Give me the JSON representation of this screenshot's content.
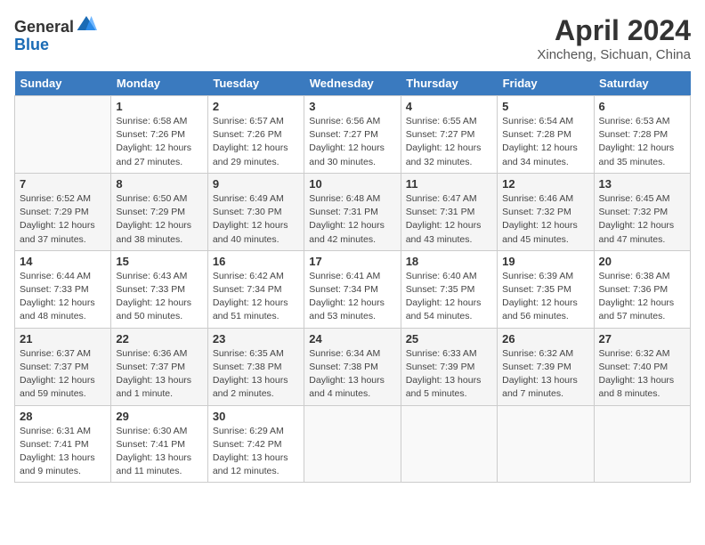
{
  "header": {
    "logo_line1": "General",
    "logo_line2": "Blue",
    "title": "April 2024",
    "subtitle": "Xincheng, Sichuan, China"
  },
  "calendar": {
    "weekdays": [
      "Sunday",
      "Monday",
      "Tuesday",
      "Wednesday",
      "Thursday",
      "Friday",
      "Saturday"
    ],
    "weeks": [
      [
        {
          "day": "",
          "info": ""
        },
        {
          "day": "1",
          "info": "Sunrise: 6:58 AM\nSunset: 7:26 PM\nDaylight: 12 hours\nand 27 minutes."
        },
        {
          "day": "2",
          "info": "Sunrise: 6:57 AM\nSunset: 7:26 PM\nDaylight: 12 hours\nand 29 minutes."
        },
        {
          "day": "3",
          "info": "Sunrise: 6:56 AM\nSunset: 7:27 PM\nDaylight: 12 hours\nand 30 minutes."
        },
        {
          "day": "4",
          "info": "Sunrise: 6:55 AM\nSunset: 7:27 PM\nDaylight: 12 hours\nand 32 minutes."
        },
        {
          "day": "5",
          "info": "Sunrise: 6:54 AM\nSunset: 7:28 PM\nDaylight: 12 hours\nand 34 minutes."
        },
        {
          "day": "6",
          "info": "Sunrise: 6:53 AM\nSunset: 7:28 PM\nDaylight: 12 hours\nand 35 minutes."
        }
      ],
      [
        {
          "day": "7",
          "info": "Sunrise: 6:52 AM\nSunset: 7:29 PM\nDaylight: 12 hours\nand 37 minutes."
        },
        {
          "day": "8",
          "info": "Sunrise: 6:50 AM\nSunset: 7:29 PM\nDaylight: 12 hours\nand 38 minutes."
        },
        {
          "day": "9",
          "info": "Sunrise: 6:49 AM\nSunset: 7:30 PM\nDaylight: 12 hours\nand 40 minutes."
        },
        {
          "day": "10",
          "info": "Sunrise: 6:48 AM\nSunset: 7:31 PM\nDaylight: 12 hours\nand 42 minutes."
        },
        {
          "day": "11",
          "info": "Sunrise: 6:47 AM\nSunset: 7:31 PM\nDaylight: 12 hours\nand 43 minutes."
        },
        {
          "day": "12",
          "info": "Sunrise: 6:46 AM\nSunset: 7:32 PM\nDaylight: 12 hours\nand 45 minutes."
        },
        {
          "day": "13",
          "info": "Sunrise: 6:45 AM\nSunset: 7:32 PM\nDaylight: 12 hours\nand 47 minutes."
        }
      ],
      [
        {
          "day": "14",
          "info": "Sunrise: 6:44 AM\nSunset: 7:33 PM\nDaylight: 12 hours\nand 48 minutes."
        },
        {
          "day": "15",
          "info": "Sunrise: 6:43 AM\nSunset: 7:33 PM\nDaylight: 12 hours\nand 50 minutes."
        },
        {
          "day": "16",
          "info": "Sunrise: 6:42 AM\nSunset: 7:34 PM\nDaylight: 12 hours\nand 51 minutes."
        },
        {
          "day": "17",
          "info": "Sunrise: 6:41 AM\nSunset: 7:34 PM\nDaylight: 12 hours\nand 53 minutes."
        },
        {
          "day": "18",
          "info": "Sunrise: 6:40 AM\nSunset: 7:35 PM\nDaylight: 12 hours\nand 54 minutes."
        },
        {
          "day": "19",
          "info": "Sunrise: 6:39 AM\nSunset: 7:35 PM\nDaylight: 12 hours\nand 56 minutes."
        },
        {
          "day": "20",
          "info": "Sunrise: 6:38 AM\nSunset: 7:36 PM\nDaylight: 12 hours\nand 57 minutes."
        }
      ],
      [
        {
          "day": "21",
          "info": "Sunrise: 6:37 AM\nSunset: 7:37 PM\nDaylight: 12 hours\nand 59 minutes."
        },
        {
          "day": "22",
          "info": "Sunrise: 6:36 AM\nSunset: 7:37 PM\nDaylight: 13 hours\nand 1 minute."
        },
        {
          "day": "23",
          "info": "Sunrise: 6:35 AM\nSunset: 7:38 PM\nDaylight: 13 hours\nand 2 minutes."
        },
        {
          "day": "24",
          "info": "Sunrise: 6:34 AM\nSunset: 7:38 PM\nDaylight: 13 hours\nand 4 minutes."
        },
        {
          "day": "25",
          "info": "Sunrise: 6:33 AM\nSunset: 7:39 PM\nDaylight: 13 hours\nand 5 minutes."
        },
        {
          "day": "26",
          "info": "Sunrise: 6:32 AM\nSunset: 7:39 PM\nDaylight: 13 hours\nand 7 minutes."
        },
        {
          "day": "27",
          "info": "Sunrise: 6:32 AM\nSunset: 7:40 PM\nDaylight: 13 hours\nand 8 minutes."
        }
      ],
      [
        {
          "day": "28",
          "info": "Sunrise: 6:31 AM\nSunset: 7:41 PM\nDaylight: 13 hours\nand 9 minutes."
        },
        {
          "day": "29",
          "info": "Sunrise: 6:30 AM\nSunset: 7:41 PM\nDaylight: 13 hours\nand 11 minutes."
        },
        {
          "day": "30",
          "info": "Sunrise: 6:29 AM\nSunset: 7:42 PM\nDaylight: 13 hours\nand 12 minutes."
        },
        {
          "day": "",
          "info": ""
        },
        {
          "day": "",
          "info": ""
        },
        {
          "day": "",
          "info": ""
        },
        {
          "day": "",
          "info": ""
        }
      ]
    ]
  }
}
